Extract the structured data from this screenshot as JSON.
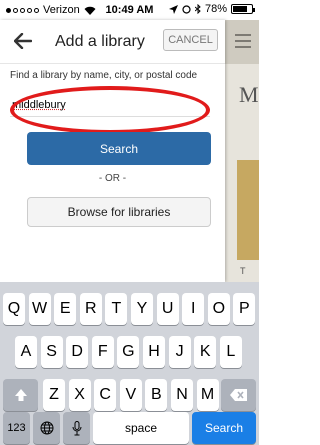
{
  "status_bar": {
    "carrier": "Verizon",
    "time": "10:49 AM",
    "battery": "78%",
    "battery_level": 0.78
  },
  "nav": {
    "title": "Add a library",
    "cancel_label": "CANCEL"
  },
  "form": {
    "prompt": "Find a library by name, city, or postal code",
    "search_value": "middlebury",
    "search_button": "Search",
    "or_label": "- OR -",
    "browse_button": "Browse for libraries"
  },
  "background_app": {
    "heading_letter": "M",
    "label_letter": "T"
  },
  "keyboard": {
    "row1": [
      "Q",
      "W",
      "E",
      "R",
      "T",
      "Y",
      "U",
      "I",
      "O",
      "P"
    ],
    "row2": [
      "A",
      "S",
      "D",
      "F",
      "G",
      "H",
      "J",
      "K",
      "L"
    ],
    "row3": [
      "Z",
      "X",
      "C",
      "V",
      "B",
      "N",
      "M"
    ],
    "numbers_key": "123",
    "space_key": "space",
    "return_key": "Search"
  },
  "colors": {
    "primary_button": "#2c6aa6",
    "annotation": "#e11b1b",
    "keyboard_bg": "#d1d4da",
    "search_key": "#1a7fe6"
  }
}
